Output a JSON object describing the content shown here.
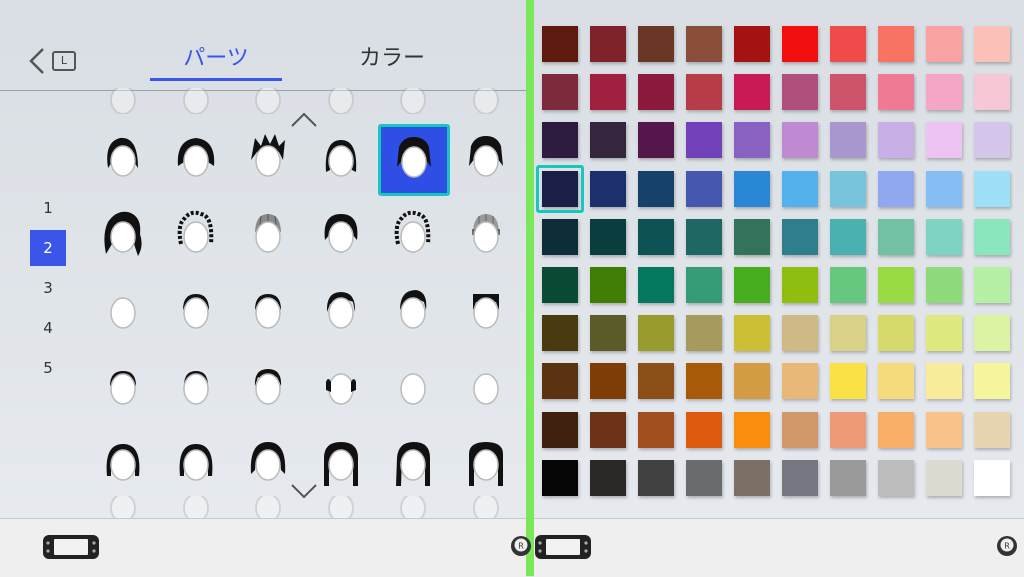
{
  "header": {
    "back_key": "L",
    "tabs": [
      {
        "label": "パーツ",
        "active": true
      },
      {
        "label": "カラー",
        "active": false
      }
    ]
  },
  "pages": [
    {
      "label": "1",
      "active": false
    },
    {
      "label": "2",
      "active": true
    },
    {
      "label": "3",
      "active": false
    },
    {
      "label": "4",
      "active": false
    },
    {
      "label": "5",
      "active": false
    }
  ],
  "hair_styles": {
    "rows": 5,
    "cols": 6,
    "selected_index": 4,
    "icons": [
      "short-messy-hair-icon",
      "bob-hair-icon",
      "spiky-hair-icon",
      "medium-hair-icon",
      "spiky-shaggy-hair-icon",
      "spiky-shaggy-hair-icon",
      "long-wavy-hair-icon",
      "curly-outline-hair-icon",
      "beanie-hat-icon",
      "mushroom-bob-hair-icon",
      "curly-outline-hair-icon",
      "knit-hat-icon",
      "buzz-cut-icon",
      "short-crop-icon",
      "widow-peak-icon",
      "side-swept-icon",
      "pompadour-icon",
      "flat-top-icon",
      "side-part-icon",
      "short-side-icon",
      "tousled-short-icon",
      "ear-tufts-icon",
      "bald-icon",
      "",
      "bob-bangs-icon",
      "bob-bangs-icon",
      "round-bob-icon",
      "long-straight-icon",
      "long-side-part-icon",
      "long-bangs-icon"
    ]
  },
  "colors": {
    "selected_index": 30,
    "palette": [
      "#5e1a0f",
      "#7f2229",
      "#6a3626",
      "#8a4f3b",
      "#a51212",
      "#f20f0f",
      "#ef4b4b",
      "#f87363",
      "#f8a2a2",
      "#fbc0b8",
      "#7c2a3c",
      "#a11f3f",
      "#8b1a3d",
      "#b63d48",
      "#c81b56",
      "#b04f7c",
      "#cd546b",
      "#f07a94",
      "#f5a6c6",
      "#f8c7d6",
      "#2d1c40",
      "#33263d",
      "#55164b",
      "#7240b8",
      "#8a63c2",
      "#c08ad3",
      "#a998cf",
      "#c8b0e6",
      "#ecc3f3",
      "#d5c7ec",
      "#1a1f47",
      "#1e2f6e",
      "#15416b",
      "#4657b0",
      "#2a87d6",
      "#54b1ee",
      "#78c4dc",
      "#8fa8f0",
      "#86bdf5",
      "#9ee0f8",
      "#0d2d38",
      "#0a3e3e",
      "#0d5356",
      "#1f6763",
      "#35725a",
      "#2e7f8b",
      "#4ab1b0",
      "#72c1a2",
      "#7fd3c1",
      "#8be6bd",
      "#0b4a34",
      "#3f7d05",
      "#04775f",
      "#369c75",
      "#46ad1e",
      "#8fbe11",
      "#66c87e",
      "#9ada45",
      "#8fdb7b",
      "#b6f0a5",
      "#4a3a10",
      "#5c5c2b",
      "#999b2c",
      "#a69a5f",
      "#cdbf35",
      "#cfb987",
      "#d9d185",
      "#d6da6a",
      "#deea80",
      "#dbf3a2",
      "#5c3310",
      "#7e3e05",
      "#8c5017",
      "#a85a0a",
      "#d39c45",
      "#e8b879",
      "#fae244",
      "#f6db7c",
      "#f8eb9a",
      "#f6f59d",
      "#40200f",
      "#6e3317",
      "#a24e1e",
      "#de5a0e",
      "#f98e0c",
      "#d1996a",
      "#ee9a78",
      "#f7ae67",
      "#f9c28a",
      "#e8d3b3",
      "#050505",
      "#2c2828",
      "#414141",
      "#6a6b6c",
      "#7b6f66",
      "#767781",
      "#9a9a9a",
      "#bcbcbc",
      "#dcdbd1",
      "#ffffff"
    ]
  }
}
